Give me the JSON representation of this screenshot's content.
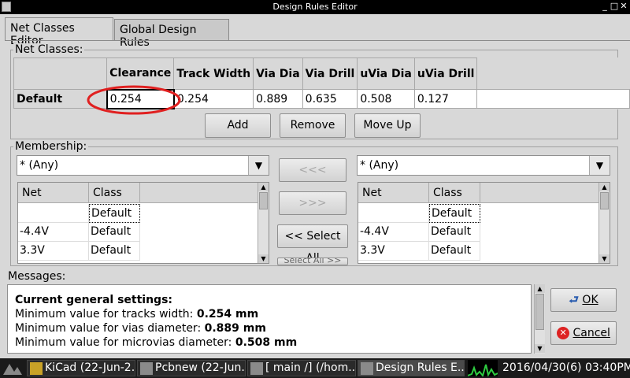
{
  "window": {
    "title": "Design Rules Editor"
  },
  "tabs": [
    {
      "label": "Net Classes Editor"
    },
    {
      "label": "Global Design Rules"
    }
  ],
  "net_classes": {
    "group_label": "Net Classes:",
    "columns": [
      "Clearance",
      "Track Width",
      "Via Dia",
      "Via Drill",
      "uVia Dia",
      "uVia Drill"
    ],
    "rows": [
      {
        "name": "Default",
        "values": [
          "0.254",
          "0.254",
          "0.889",
          "0.635",
          "0.508",
          "0.127"
        ]
      }
    ],
    "buttons": {
      "add": "Add",
      "remove": "Remove",
      "move_up": "Move Up"
    }
  },
  "membership": {
    "group_label": "Membership:",
    "left_filter": "* (Any)",
    "right_filter": "* (Any)",
    "columns": [
      "Net",
      "Class"
    ],
    "left_rows": [
      {
        "net": "",
        "class": "Default"
      },
      {
        "net": "-4.4V",
        "class": "Default"
      },
      {
        "net": "3.3V",
        "class": "Default"
      }
    ],
    "right_rows": [
      {
        "net": "",
        "class": "Default"
      },
      {
        "net": "-4.4V",
        "class": "Default"
      },
      {
        "net": "3.3V",
        "class": "Default"
      }
    ],
    "buttons": {
      "move_left": "<<<",
      "move_right": ">>>",
      "select_all": "<< Select All",
      "partial": "Select All >>"
    }
  },
  "messages": {
    "group_label": "Messages:",
    "heading": "Current general settings:",
    "lines": [
      {
        "label": "Minimum value for tracks width:",
        "value": "0.254 mm"
      },
      {
        "label": "Minimum value for vias diameter:",
        "value": "0.889 mm"
      },
      {
        "label": "Minimum value for microvias diameter:",
        "value": "0.508 mm"
      }
    ]
  },
  "dialog_buttons": {
    "ok": "OK",
    "cancel": "Cancel"
  },
  "taskbar": {
    "items": [
      {
        "label": "KiCad (22-Jun-2..."
      },
      {
        "label": "Pcbnew (22-Jun..."
      },
      {
        "label": "[ main /] (/hom..."
      },
      {
        "label": "Design Rules E..."
      }
    ],
    "clock": "2016/04/30(6) 03:40PM"
  },
  "colors": {
    "highlight_circle": "#e02020",
    "taskbar_bg": "#1a1a1a"
  }
}
